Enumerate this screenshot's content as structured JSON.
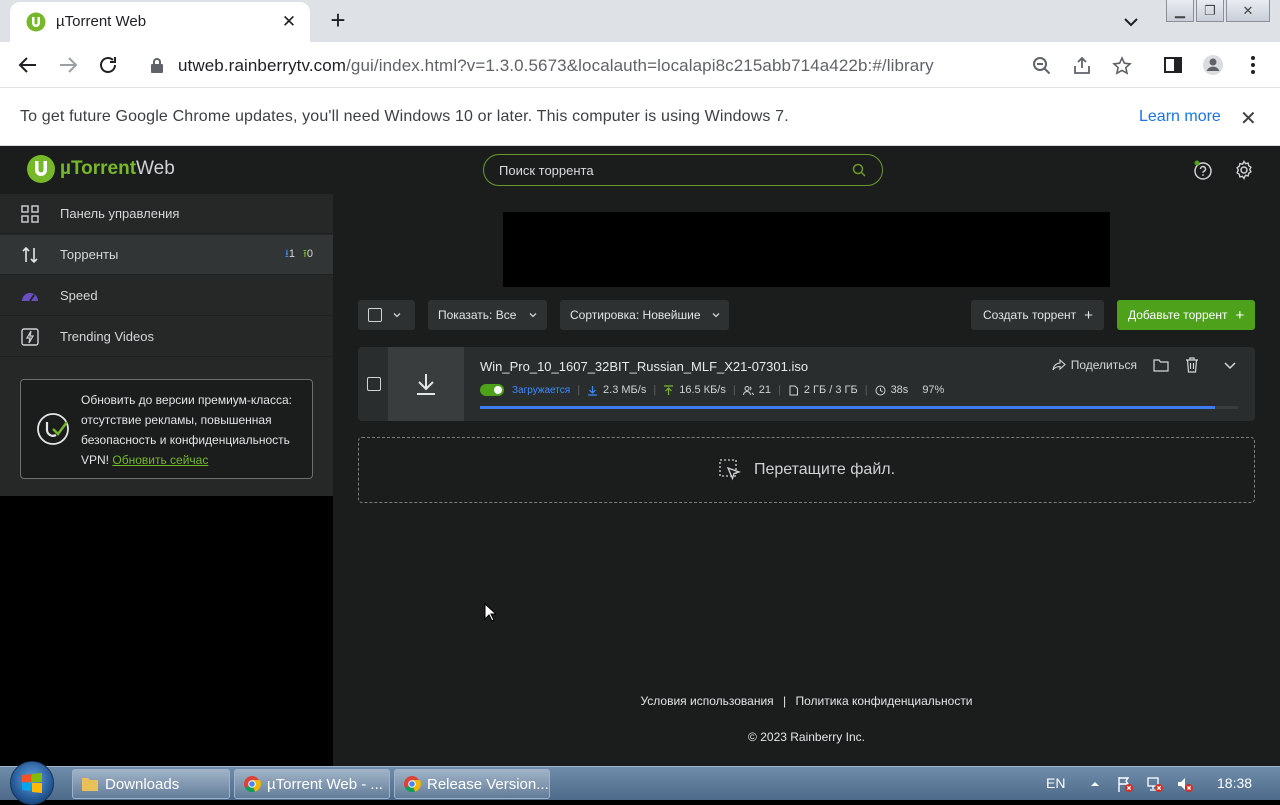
{
  "browser": {
    "tab_title": "µTorrent Web",
    "url_host": "utweb.rainberrytv.com",
    "url_path": "/gui/index.html?v=1.3.0.5673&localauth=localapi8c215abb714a422b:#/library",
    "infobar_text": "To get future Google Chrome updates, you'll need Windows 10 or later. This computer is using Windows 7.",
    "learn_more": "Learn more"
  },
  "app": {
    "logo_mu": "µTorrent",
    "logo_web": "Web",
    "search_placeholder": "Поиск торрента",
    "sidebar": {
      "items": [
        {
          "label": "Панель управления",
          "icon": "dashboard-icon"
        },
        {
          "label": "Торренты",
          "icon": "transfer-icon",
          "downloading": "1",
          "seeding": "0"
        },
        {
          "label": "Speed",
          "icon": "speedometer-icon"
        },
        {
          "label": "Trending Videos",
          "icon": "trending-icon"
        }
      ],
      "promo_text": "Обновить до версии премиум-класса: отсутствие рекламы, повышенная безопасность и конфиденциальность VPN!",
      "promo_link": "Обновить сейчас"
    },
    "controls": {
      "show_label": "Показать:",
      "show_value": "Все",
      "sort_label": "Сортировка:",
      "sort_value": "Новейшие",
      "create_torrent": "Создать торрент",
      "add_torrent": "Добавьте торрент"
    },
    "torrent": {
      "name": "Win_Pro_10_1607_32BIT_Russian_MLF_X21-07301.iso",
      "status": "Загружается",
      "download_speed": "2.3 МБ/s",
      "upload_speed": "16.5 КБ/s",
      "peers": "21",
      "size": "2 ГБ / 3 ГБ",
      "eta": "38s",
      "percent": "97%",
      "progress": 0.97,
      "share_label": "Поделиться"
    },
    "dropzone_label": "Перетащите файл.",
    "footer": {
      "terms": "Условия использования",
      "separator": "|",
      "privacy": "Политика конфиденциальности",
      "copyright": "© 2023 Rainberry Inc."
    },
    "colors": {
      "accent_green": "#76b82a",
      "button_green": "#4ea11b",
      "progress_blue": "#3d7cf0",
      "background": "#1b1d1d"
    }
  },
  "taskbar": {
    "items": [
      {
        "label": "Downloads"
      },
      {
        "label": "µTorrent Web - ..."
      },
      {
        "label": "Release Version..."
      }
    ],
    "language": "EN",
    "time": "18:38"
  }
}
